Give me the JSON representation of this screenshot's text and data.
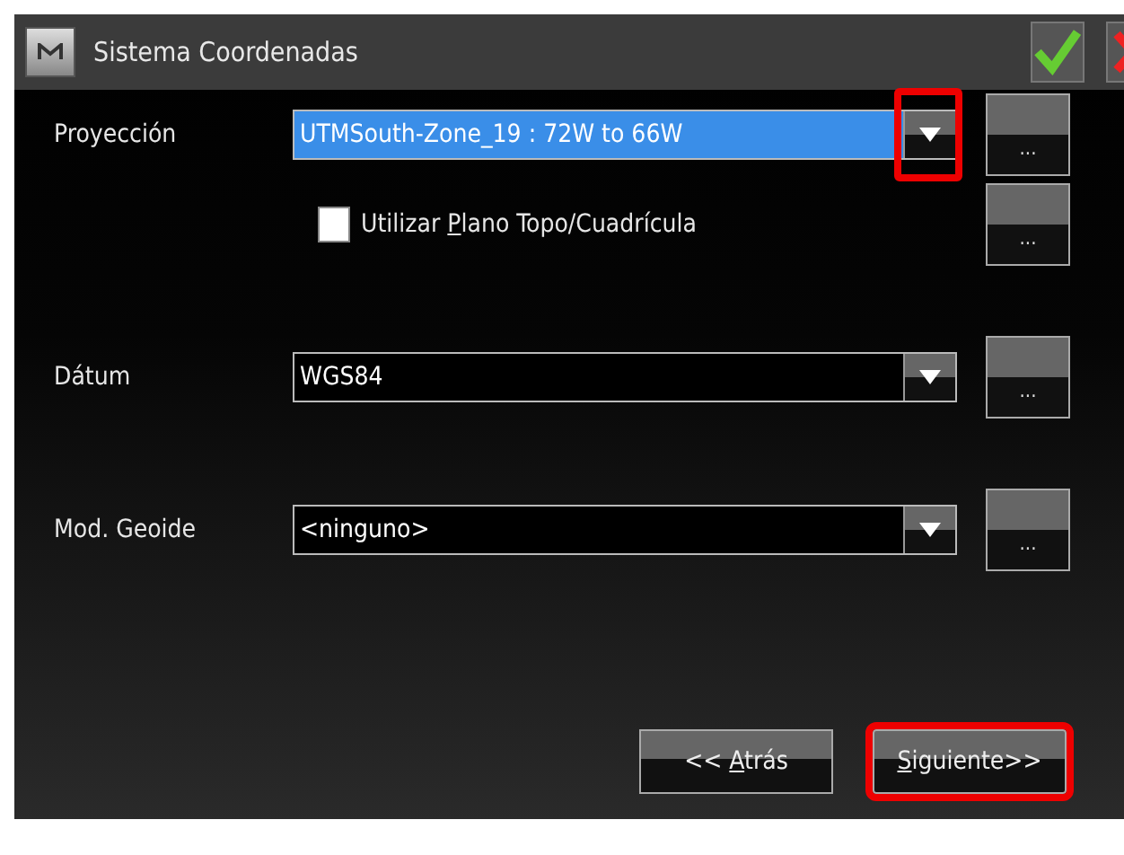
{
  "window": {
    "title": "Sistema Coordenadas"
  },
  "fields": [
    {
      "kind": "dropdown",
      "label": "Proyección",
      "value": "UTMSouth-Zone_19 : 72W to 66W",
      "focused": true,
      "highlighted": true
    },
    {
      "kind": "checkbox",
      "label_before": "Utilizar ",
      "mnemonic": "P",
      "label_after": "lano Topo/Cuadrícula",
      "checked": false
    },
    {
      "kind": "dropdown",
      "label": "Dátum",
      "value": "WGS84",
      "focused": false,
      "highlighted": false
    },
    {
      "kind": "dropdown",
      "label": "Mod. Geoide",
      "value": "<ninguno>",
      "focused": false,
      "highlighted": false
    }
  ],
  "more_button": "...",
  "buttons": [
    {
      "label_before": "<< ",
      "mnemonic": "A",
      "label_after": "trás",
      "highlighted": false
    },
    {
      "mnemonic": "S",
      "label_after": "iguiente>>",
      "highlighted": true
    }
  ]
}
